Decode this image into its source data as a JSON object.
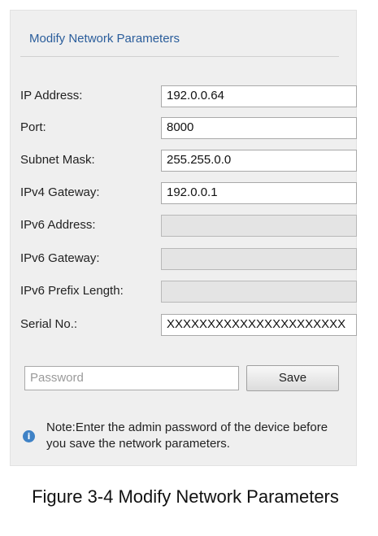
{
  "panel": {
    "title": "Modify Network Parameters"
  },
  "fields": [
    {
      "label": "IP Address:",
      "value": "192.0.0.64",
      "enabled": true
    },
    {
      "label": "Port:",
      "value": "8000",
      "enabled": true
    },
    {
      "label": "Subnet Mask:",
      "value": "255.255.0.0",
      "enabled": true
    },
    {
      "label": "IPv4 Gateway:",
      "value": "192.0.0.1",
      "enabled": true
    },
    {
      "label": "IPv6 Address:",
      "value": "",
      "enabled": false
    },
    {
      "label": "IPv6 Gateway:",
      "value": "",
      "enabled": false
    },
    {
      "label": "IPv6 Prefix Length:",
      "value": "",
      "enabled": false
    },
    {
      "label": "Serial No.:",
      "value": "XXXXXXXXXXXXXXXXXXXXXX",
      "enabled": true
    }
  ],
  "password": {
    "placeholder": "Password"
  },
  "save_label": "Save",
  "note": "Note:Enter the admin password of the device before you save the network parameters.",
  "info_icon": {
    "name": "info-icon",
    "glyph": "i"
  },
  "caption": "Figure 3-4 Modify Network Parameters"
}
